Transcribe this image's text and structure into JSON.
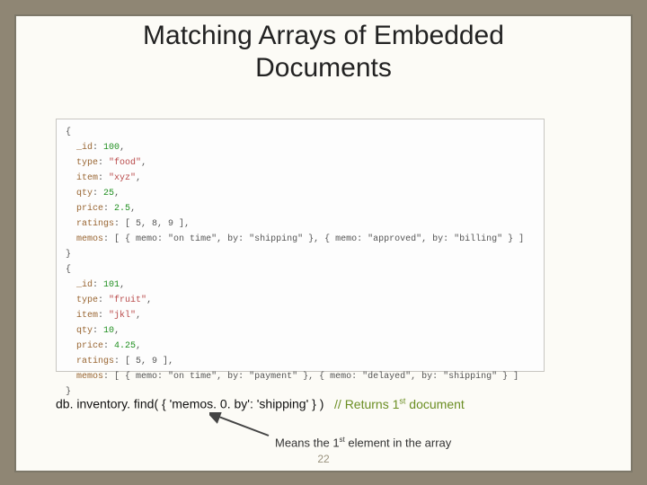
{
  "title_line1": "Matching Arrays of Embedded",
  "title_line2": "Documents",
  "doc1": {
    "id": "100",
    "type": "\"food\"",
    "item": "\"xyz\"",
    "qty": "25",
    "price": "2.5",
    "ratings": "[ 5, 8, 9 ]",
    "memos": "[ { memo: \"on time\", by: \"shipping\" }, { memo: \"approved\", by: \"billing\" } ]"
  },
  "doc2": {
    "id": "101",
    "type": "\"fruit\"",
    "item": "\"jkl\"",
    "qty": "10",
    "price": "4.25",
    "ratings": "[ 5, 9 ]",
    "memos": "[ { memo: \"on time\", by: \"payment\" }, { memo: \"delayed\", by: \"shipping\" } ]"
  },
  "query": "db. inventory. find( { 'memos. 0. by': 'shipping' } )",
  "comment": "// Returns 1",
  "comment_sup": "st",
  "comment_tail": " document",
  "caption_pre": "Means the 1",
  "caption_sup": "st",
  "caption_post": " element in the array",
  "page": "22"
}
